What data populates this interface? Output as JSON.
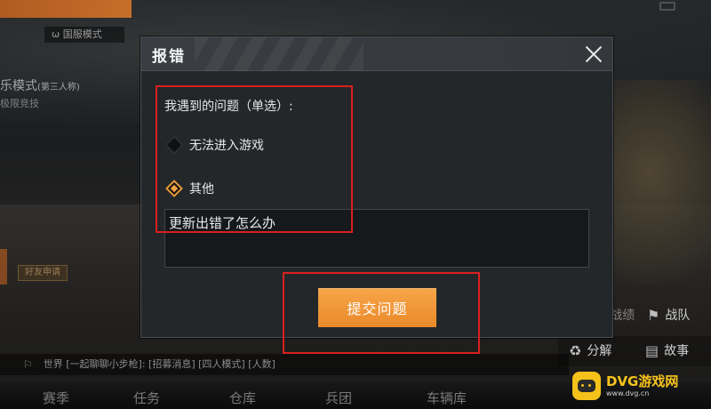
{
  "background": {
    "mode_tag": "ω 国服模式",
    "mode_title": "乐模式",
    "mode_title_suffix": "(第三人称)",
    "mode_sub": "极限竞技",
    "mid_tag": "好友申请",
    "chat_text": "世界 [一起聊聊小步枪]: [招募消息] [四人模式] [人数]",
    "side_buttons": [
      {
        "label": "战绩",
        "icon": "shield-icon"
      },
      {
        "label": "战队",
        "icon": "flags-icon"
      },
      {
        "label": "分解",
        "icon": "recycle-icon"
      },
      {
        "label": "故事",
        "icon": "book-icon"
      }
    ],
    "bottom_nav": [
      "赛季",
      "任务",
      "仓库",
      "兵团",
      "车辆库"
    ]
  },
  "dialog": {
    "title": "报错",
    "question": "我遇到的问题（单选）:",
    "options": [
      {
        "label": "无法进入游戏",
        "selected": false
      },
      {
        "label": "其他",
        "selected": true
      }
    ],
    "textarea_value": "更新出错了怎么办",
    "submit_label": "提交问题"
  },
  "colors": {
    "accent": "#ea8a2b",
    "annotation": "#d8201f",
    "watermark": "#f7c31c"
  },
  "watermark": {
    "brand": "DVG游戏网",
    "url": "www.dvg.cn"
  }
}
